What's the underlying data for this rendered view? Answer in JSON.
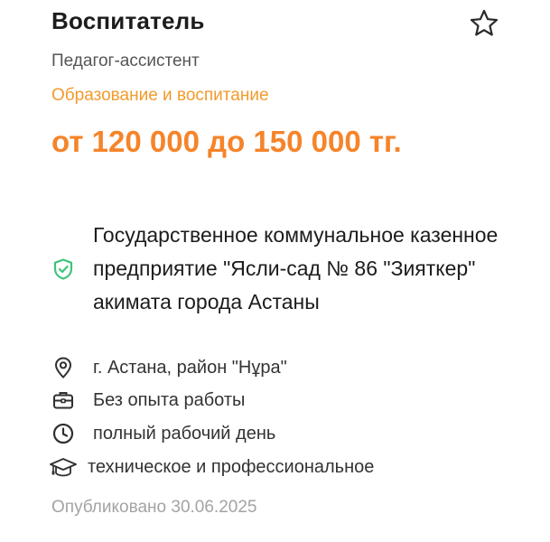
{
  "job": {
    "title": "Воспитатель",
    "subtitle": "Педагог-ассистент",
    "category": "Образование и воспитание",
    "salary": "от 120 000 до 150 000 тг.",
    "employer": "Государственное коммунальное казенное предприятие \"Ясли-сад № 86 \"Зияткер\" акимата города Астаны",
    "location": "г. Астана, район \"Нұра\"",
    "experience": "Без опыта работы",
    "schedule": "полный рабочий день",
    "education": "техническое и профессиональное",
    "published": "Опубликовано 30.06.2025"
  },
  "icons": {
    "favorite": "star-icon",
    "employer": "shield-check-icon",
    "location": "location-pin-icon",
    "experience": "briefcase-icon",
    "schedule": "clock-icon",
    "education": "graduation-cap-icon"
  },
  "colors": {
    "accent": "#f5842a",
    "category": "#f39a2b",
    "verified": "#3cc47a",
    "muted": "#a3a3a3"
  }
}
